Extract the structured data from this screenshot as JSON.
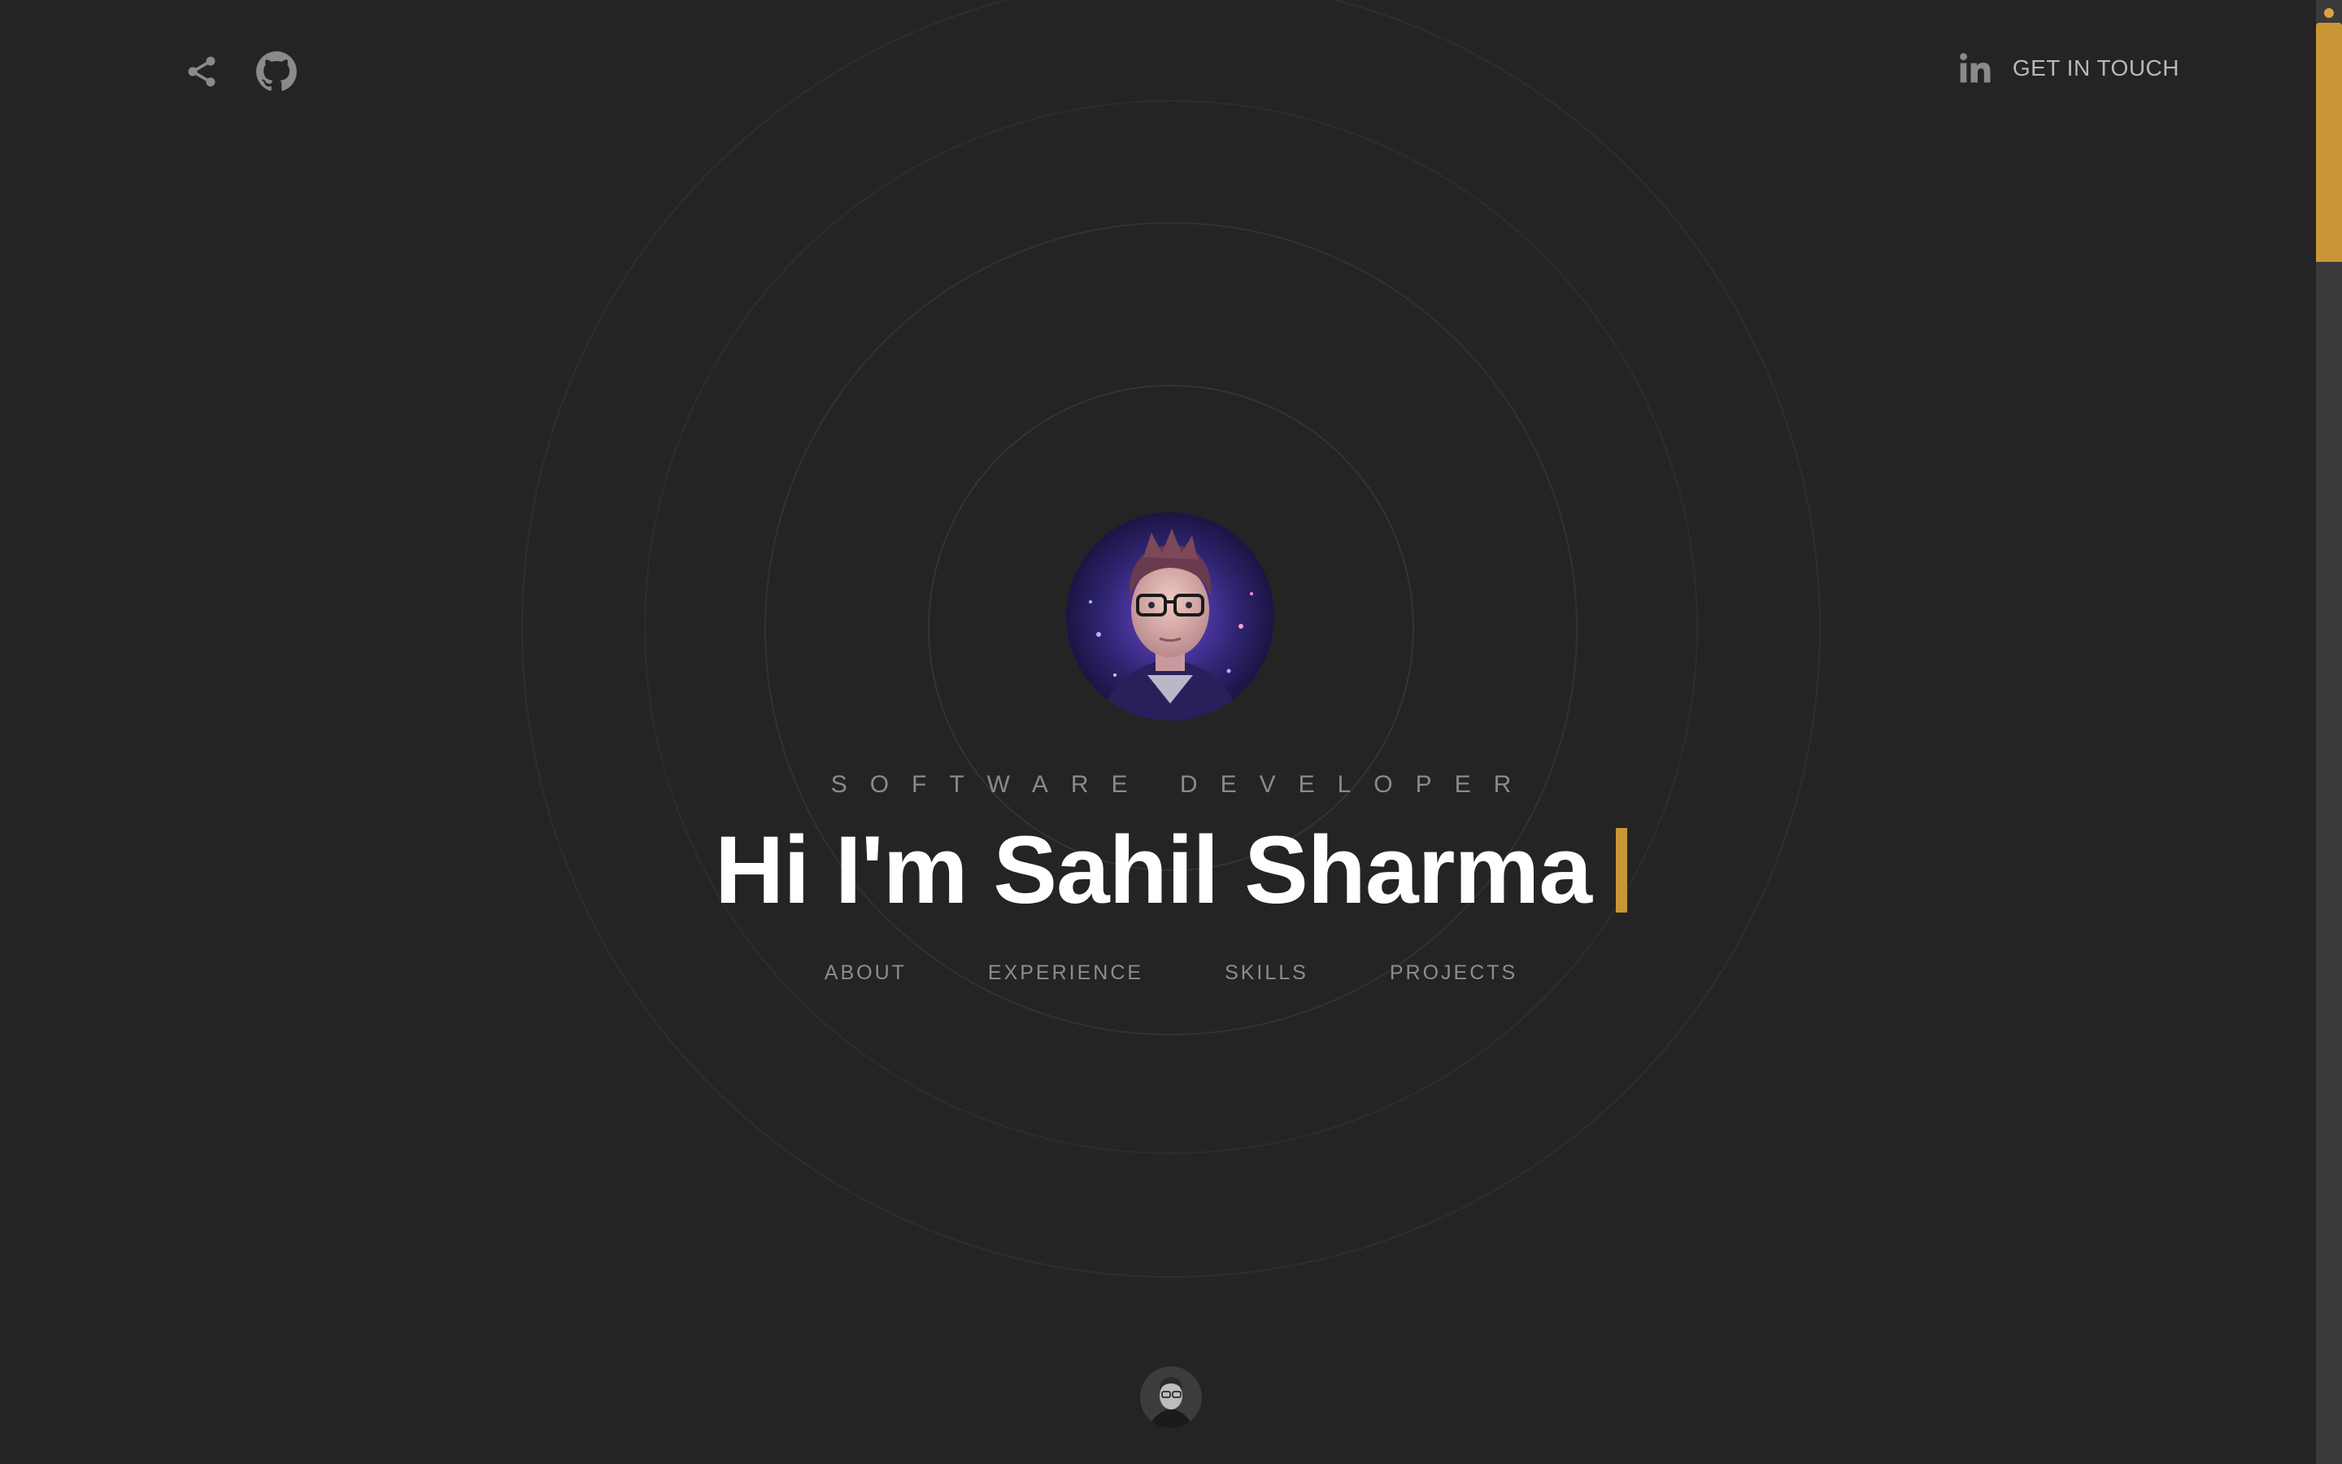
{
  "header": {
    "share_icon": "share-icon",
    "github_icon": "github-icon",
    "linkedin_icon": "linkedin-icon",
    "cta_label": "GET IN TOUCH"
  },
  "hero": {
    "avatar_alt": "portrait-avatar",
    "role": "SOFTWARE DEVELOPER",
    "title": "Hi I'm Sahil Sharma",
    "cursor_color": "#c99636"
  },
  "nav": {
    "items": [
      {
        "label": "ABOUT"
      },
      {
        "label": "EXPERIENCE"
      },
      {
        "label": "SKILLS"
      },
      {
        "label": "PROJECTS"
      }
    ]
  },
  "colors": {
    "background": "#242424",
    "accent": "#c99636",
    "text_primary": "#ffffff",
    "text_muted": "#8a8a8a"
  }
}
